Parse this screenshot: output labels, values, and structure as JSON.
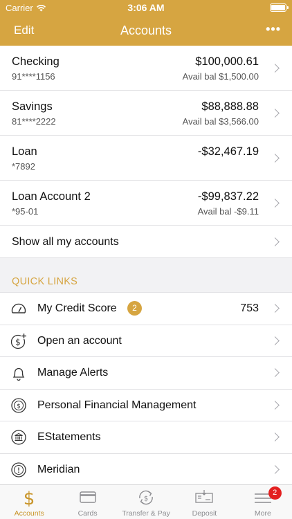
{
  "status_bar": {
    "carrier": "Carrier",
    "time": "3:06 AM"
  },
  "nav": {
    "edit_label": "Edit",
    "title": "Accounts",
    "more_label": "•••"
  },
  "accounts": [
    {
      "name": "Checking",
      "number": "91****1156",
      "balance": "$100,000.61",
      "avail": "Avail bal $1,500.00"
    },
    {
      "name": "Savings",
      "number": "81****2222",
      "balance": "$88,888.88",
      "avail": "Avail bal $3,566.00"
    },
    {
      "name": "Loan",
      "number": "*7892",
      "balance": "-$32,467.19",
      "avail": ""
    },
    {
      "name": "Loan Account 2",
      "number": "*95-01",
      "balance": "-$99,837.22",
      "avail": "Avail bal -$9.11"
    }
  ],
  "show_all_label": "Show all my accounts",
  "quick_links": {
    "heading": "QUICK LINKS",
    "items": [
      {
        "label": "My Credit Score",
        "icon": "gauge-icon",
        "badge": "2",
        "value": "753"
      },
      {
        "label": "Open an account",
        "icon": "dollar-plus-icon"
      },
      {
        "label": "Manage Alerts",
        "icon": "bell-icon"
      },
      {
        "label": "Personal Financial Management",
        "icon": "dollar-circle-icon"
      },
      {
        "label": "EStatements",
        "icon": "bank-icon"
      },
      {
        "label": "Meridian",
        "icon": "info-circle-icon"
      }
    ]
  },
  "tabbar": {
    "items": [
      {
        "label": "Accounts",
        "icon": "dollar-icon",
        "active": true
      },
      {
        "label": "Cards",
        "icon": "card-icon"
      },
      {
        "label": "Transfer & Pay",
        "icon": "transfer-icon"
      },
      {
        "label": "Deposit",
        "icon": "check-deposit-icon"
      },
      {
        "label": "More",
        "icon": "menu-icon",
        "badge": "2"
      }
    ]
  },
  "colors": {
    "brand_gold": "#d6a541",
    "badge_red": "#e32020"
  }
}
